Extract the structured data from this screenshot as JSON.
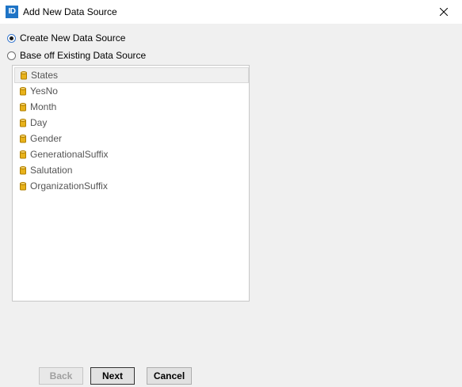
{
  "window": {
    "title": "Add New Data Source",
    "app_icon_text": "ID",
    "app_icon_color": "#1e74c6"
  },
  "options": {
    "create_new_label": "Create New Data Source",
    "create_new_checked": true,
    "base_existing_label": "Base off Existing Data Source",
    "base_existing_checked": false
  },
  "data_sources": {
    "selected_index": 0,
    "items": [
      {
        "label": "States",
        "icon": "database-icon"
      },
      {
        "label": "YesNo",
        "icon": "database-icon"
      },
      {
        "label": "Month",
        "icon": "database-icon"
      },
      {
        "label": "Day",
        "icon": "database-icon"
      },
      {
        "label": "Gender",
        "icon": "database-icon"
      },
      {
        "label": "GenerationalSuffix",
        "icon": "database-icon"
      },
      {
        "label": "Salutation",
        "icon": "database-icon"
      },
      {
        "label": "OrganizationSuffix",
        "icon": "database-icon"
      }
    ]
  },
  "buttons": {
    "back_label": "Back",
    "back_enabled": false,
    "next_label": "Next",
    "cancel_label": "Cancel"
  },
  "colors": {
    "database_icon": "#e8b21a"
  }
}
